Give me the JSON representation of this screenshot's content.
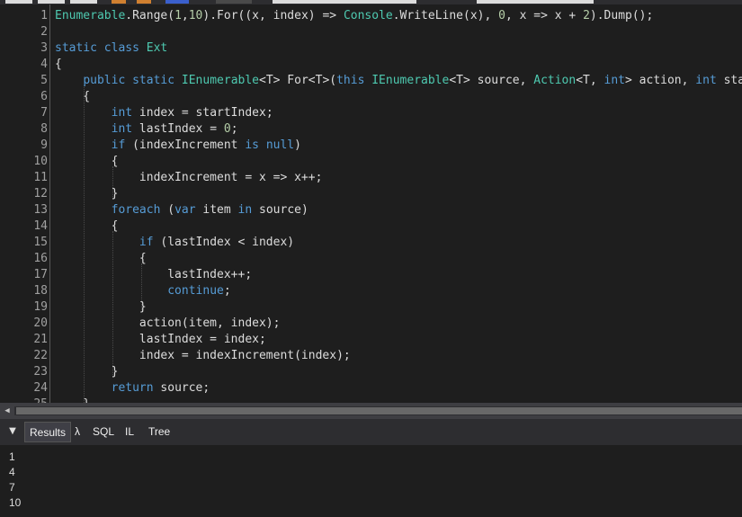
{
  "colors": {
    "keyword": "#569cd6",
    "type": "#4ec9b0",
    "number": "#b5cea8",
    "text": "#dcdcdc",
    "background": "#1e1e1e"
  },
  "editor": {
    "line_numbers": [
      "1",
      "2",
      "3",
      "4",
      "5",
      "6",
      "7",
      "8",
      "9",
      "10",
      "11",
      "12",
      "13",
      "14",
      "15",
      "16",
      "17",
      "18",
      "19",
      "20",
      "21",
      "22",
      "23",
      "24",
      "25"
    ],
    "lines": [
      [
        [
          "t",
          "Enumerable"
        ],
        [
          "p",
          ".Range("
        ],
        [
          "n",
          "1"
        ],
        [
          "p",
          ","
        ],
        [
          "n",
          "10"
        ],
        [
          "p",
          ").For((x, index) => "
        ],
        [
          "t",
          "Console"
        ],
        [
          "p",
          ".WriteLine(x), "
        ],
        [
          "n",
          "0"
        ],
        [
          "p",
          ", x => x + "
        ],
        [
          "n",
          "2"
        ],
        [
          "p",
          ").Dump();"
        ]
      ],
      [],
      [
        [
          "k",
          "static"
        ],
        [
          "p",
          " "
        ],
        [
          "k",
          "class"
        ],
        [
          "p",
          " "
        ],
        [
          "t",
          "Ext"
        ]
      ],
      [
        [
          "p",
          "{"
        ]
      ],
      [
        [
          "p",
          "    "
        ],
        [
          "k",
          "public"
        ],
        [
          "p",
          " "
        ],
        [
          "k",
          "static"
        ],
        [
          "p",
          " "
        ],
        [
          "t",
          "IEnumerable"
        ],
        [
          "p",
          "<T> For<T>("
        ],
        [
          "k",
          "this"
        ],
        [
          "p",
          " "
        ],
        [
          "t",
          "IEnumerable"
        ],
        [
          "p",
          "<T> source, "
        ],
        [
          "t",
          "Action"
        ],
        [
          "p",
          "<T, "
        ],
        [
          "k",
          "int"
        ],
        [
          "p",
          "> action, "
        ],
        [
          "k",
          "int"
        ],
        [
          "p",
          " startIndex"
        ]
      ],
      [
        [
          "p",
          "    {"
        ]
      ],
      [
        [
          "p",
          "        "
        ],
        [
          "k",
          "int"
        ],
        [
          "p",
          " index = startIndex;"
        ]
      ],
      [
        [
          "p",
          "        "
        ],
        [
          "k",
          "int"
        ],
        [
          "p",
          " lastIndex = "
        ],
        [
          "n",
          "0"
        ],
        [
          "p",
          ";"
        ]
      ],
      [
        [
          "p",
          "        "
        ],
        [
          "k",
          "if"
        ],
        [
          "p",
          " (indexIncrement "
        ],
        [
          "k",
          "is"
        ],
        [
          "p",
          " "
        ],
        [
          "k",
          "null"
        ],
        [
          "p",
          ")"
        ]
      ],
      [
        [
          "p",
          "        {"
        ]
      ],
      [
        [
          "p",
          "            indexIncrement = x => x++;"
        ]
      ],
      [
        [
          "p",
          "        }"
        ]
      ],
      [
        [
          "p",
          "        "
        ],
        [
          "k",
          "foreach"
        ],
        [
          "p",
          " ("
        ],
        [
          "k",
          "var"
        ],
        [
          "p",
          " item "
        ],
        [
          "k",
          "in"
        ],
        [
          "p",
          " source)"
        ]
      ],
      [
        [
          "p",
          "        {"
        ]
      ],
      [
        [
          "p",
          "            "
        ],
        [
          "k",
          "if"
        ],
        [
          "p",
          " (lastIndex < index)"
        ]
      ],
      [
        [
          "p",
          "            {"
        ]
      ],
      [
        [
          "p",
          "                lastIndex++;"
        ]
      ],
      [
        [
          "p",
          "                "
        ],
        [
          "k",
          "continue"
        ],
        [
          "p",
          ";"
        ]
      ],
      [
        [
          "p",
          "            }"
        ]
      ],
      [
        [
          "p",
          "            action(item, index);"
        ]
      ],
      [
        [
          "p",
          "            lastIndex = index;"
        ]
      ],
      [
        [
          "p",
          "            index = indexIncrement(index);"
        ]
      ],
      [
        [
          "p",
          "        }"
        ]
      ],
      [
        [
          "p",
          "        "
        ],
        [
          "k",
          "return"
        ],
        [
          "p",
          " source;"
        ]
      ],
      [
        [
          "p",
          "    }"
        ]
      ]
    ]
  },
  "results_panel": {
    "collapse_icon": "triangle-down-icon",
    "tabs": [
      {
        "label": "Results",
        "active": true
      },
      {
        "label": "λ",
        "active": false
      },
      {
        "label": "SQL",
        "active": false
      },
      {
        "label": "IL",
        "active": false
      },
      {
        "label": "Tree",
        "active": false
      }
    ],
    "output": [
      "1",
      "4",
      "7",
      "10"
    ]
  }
}
